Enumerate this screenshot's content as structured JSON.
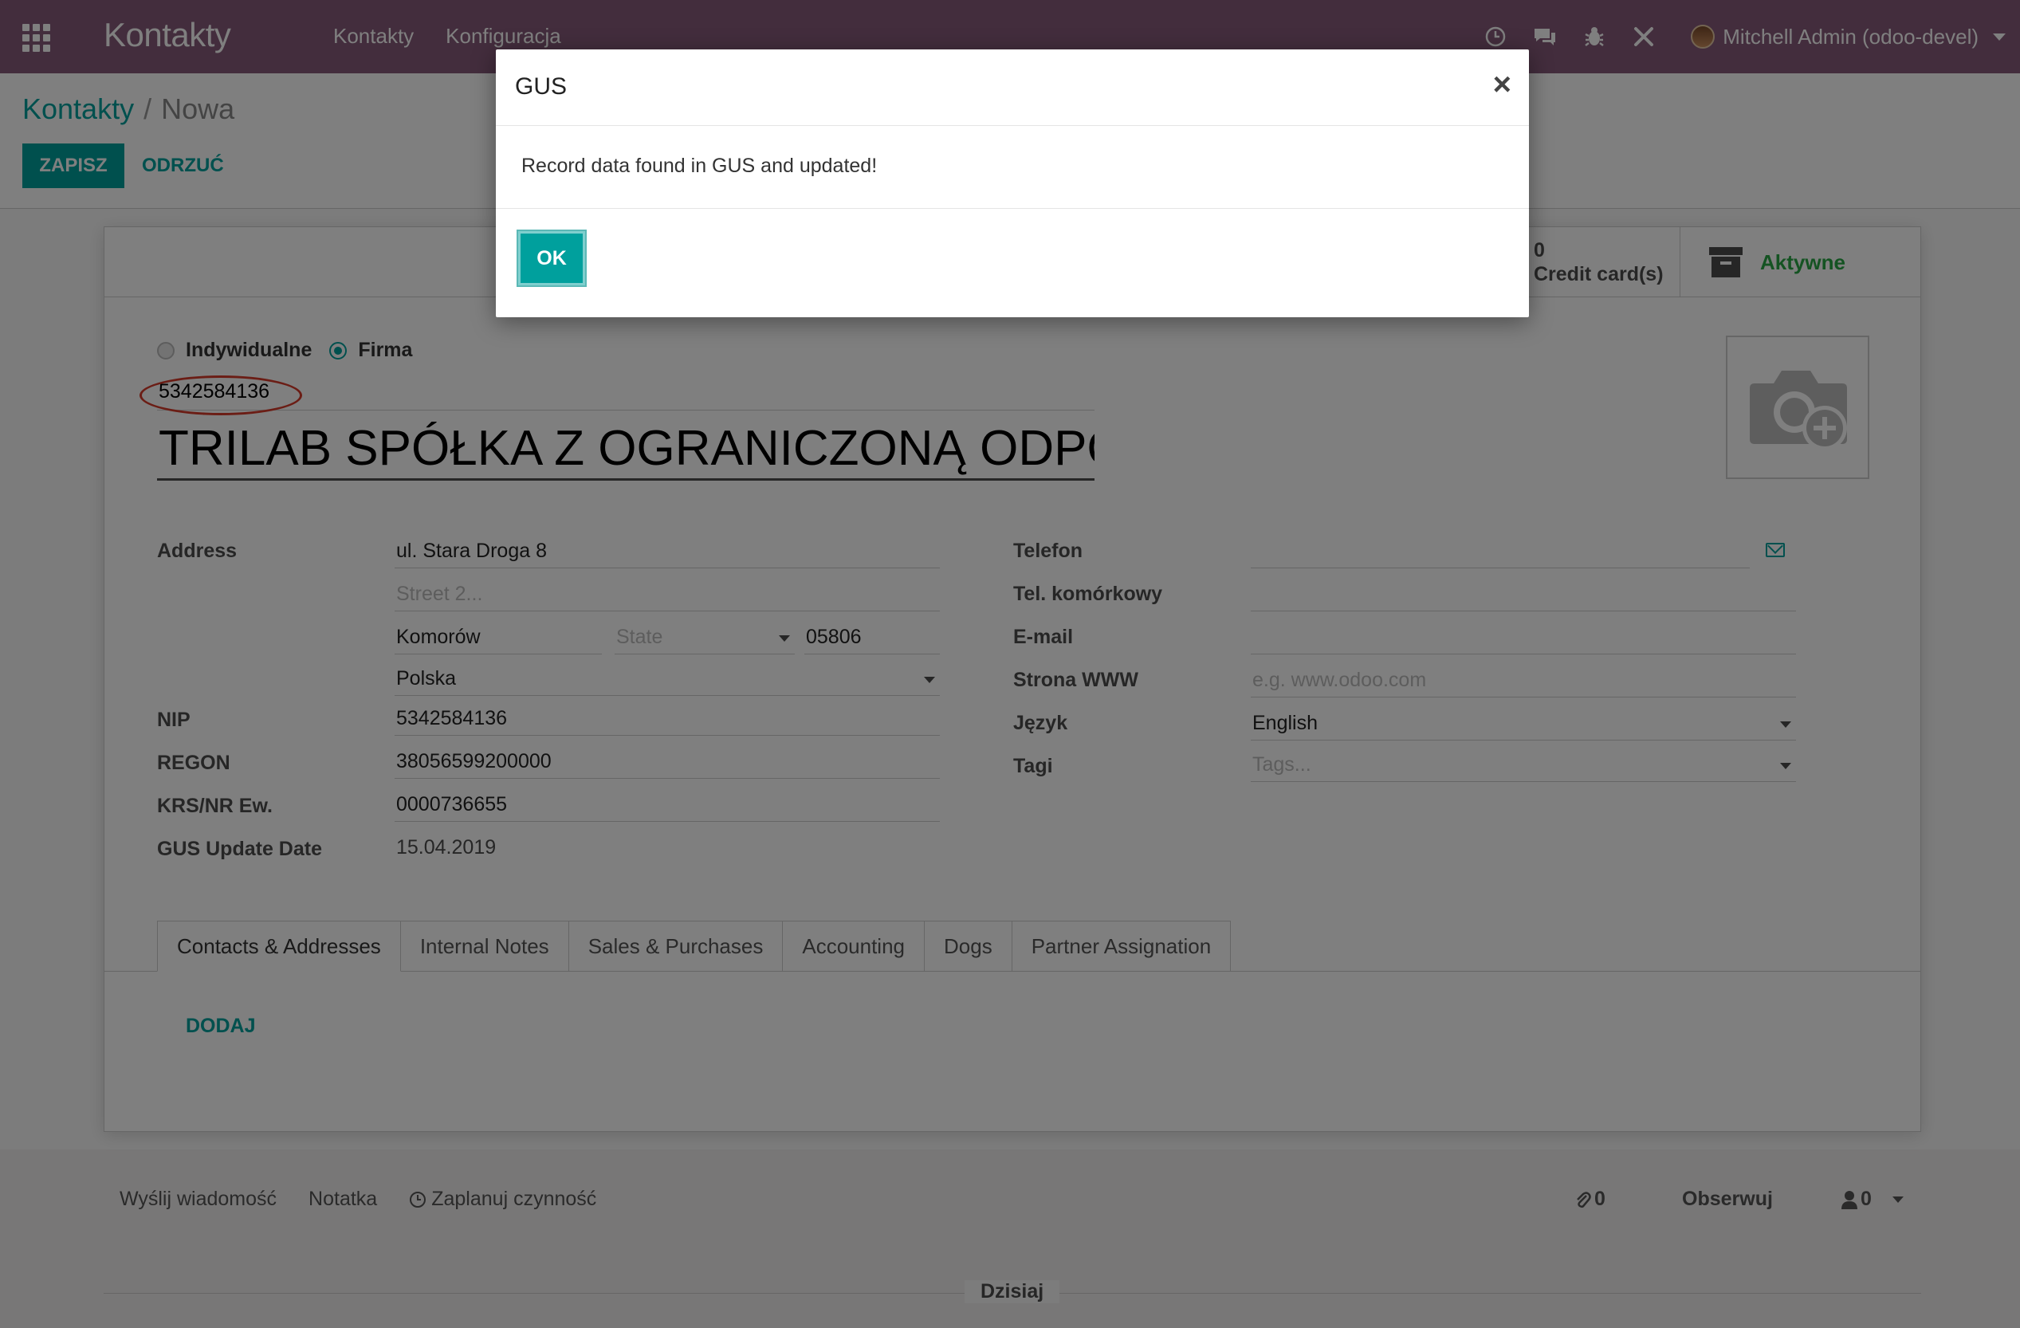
{
  "navbar": {
    "brand": "Kontakty",
    "menu": [
      "Kontakty",
      "Konfiguracja"
    ],
    "user_name": "Mitchell Admin (odoo-devel)"
  },
  "breadcrumb": {
    "parent": "Kontakty",
    "separator": "/",
    "current": "Nowa"
  },
  "actions": {
    "save": "ZAPISZ",
    "discard": "ODRZUĆ"
  },
  "stat_buttons": {
    "credit_count": "0",
    "credit_label": "Credit card(s)",
    "active_label": "Aktywne"
  },
  "company_type": {
    "individual": "Indywidualne",
    "company": "Firma",
    "selected": "company"
  },
  "vat_top": "5342584136",
  "name": "TRILAB SPÓŁKA Z OGRANICZONĄ ODPOWIEDZIALNOŚCIĄ",
  "left_fields": {
    "address_label": "Address",
    "street": "ul. Stara Droga 8",
    "street2_placeholder": "Street 2...",
    "city": "Komorów",
    "state_placeholder": "State",
    "zip": "05806",
    "country": "Polska",
    "nip_label": "NIP",
    "nip": "5342584136",
    "regon_label": "REGON",
    "regon": "38056599200000",
    "krs_label": "KRS/NR Ew.",
    "krs": "0000736655",
    "gus_label": "GUS Update Date",
    "gus_date": "15.04.2019"
  },
  "right_fields": {
    "phone_label": "Telefon",
    "mobile_label": "Tel. komórkowy",
    "email_label": "E-mail",
    "website_label": "Strona WWW",
    "website_placeholder": "e.g. www.odoo.com",
    "lang_label": "Język",
    "lang": "English",
    "tags_label": "Tagi",
    "tags_placeholder": "Tags..."
  },
  "tabs": [
    "Contacts & Addresses",
    "Internal Notes",
    "Sales & Purchases",
    "Accounting",
    "Dogs",
    "Partner Assignation"
  ],
  "add_label": "DODAJ",
  "chatter": {
    "send_message": "Wyślij wiadomość",
    "log_note": "Notatka",
    "schedule": "Zaplanuj czynność",
    "attachments": "0",
    "follow": "Obserwuj",
    "followers": "0",
    "today": "Dzisiaj"
  },
  "modal": {
    "title": "GUS",
    "close": "×",
    "message": "Record data found in GUS and updated!",
    "ok": "OK"
  },
  "colors": {
    "navbar": "#875a7b",
    "primary": "#00a09d",
    "highlight": "#d73b2a"
  }
}
